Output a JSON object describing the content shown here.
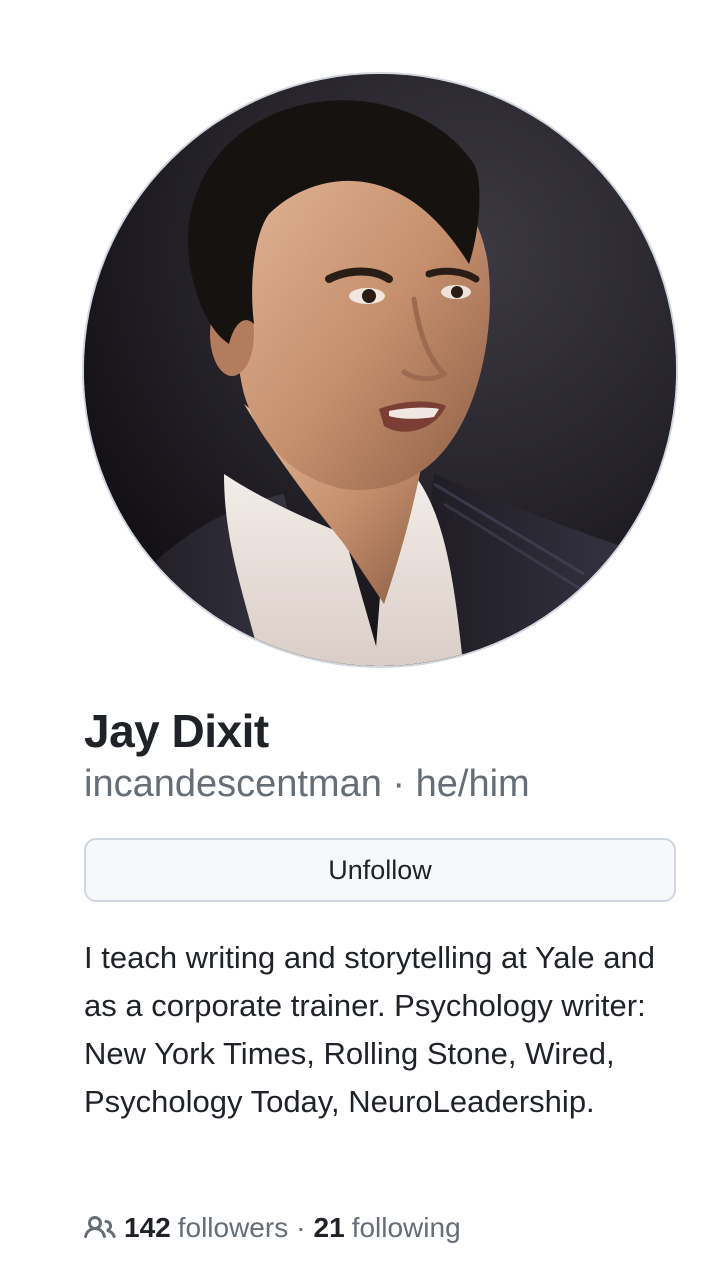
{
  "profile": {
    "avatar_icon": "profile-photo",
    "name": "Jay Dixit",
    "username": "incandescentman",
    "separator": "·",
    "pronouns": "he/him",
    "follow_button_label": "Unfollow",
    "bio": "I teach writing and storytelling at Yale and as a corporate trainer. Psychology writer: New York Times, Rolling Stone, Wired, Psychology Today, NeuroLeadership."
  },
  "stats": {
    "icon": "people-icon",
    "followers_count": "142",
    "followers_label": "followers",
    "separator": "·",
    "following_count": "21",
    "following_label": "following"
  },
  "colors": {
    "text_primary": "#1f2328",
    "text_muted": "#656d76",
    "border": "#d0d7de",
    "button_bg": "#f6f8fa"
  }
}
